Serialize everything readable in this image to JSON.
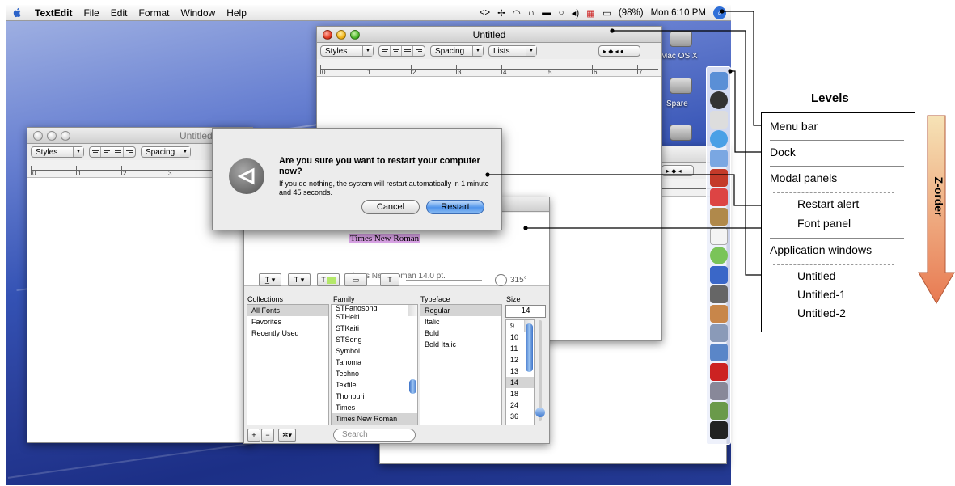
{
  "menubar": {
    "app": "TextEdit",
    "items": [
      "File",
      "Edit",
      "Format",
      "Window",
      "Help"
    ],
    "status": {
      "battery": "(98%)",
      "clock": "Mon 6:10 PM"
    }
  },
  "windows": {
    "untitled": {
      "title": "Untitled",
      "styles": "Styles",
      "spacing": "Spacing",
      "lists": "Lists",
      "ruler": [
        "0",
        "1",
        "2",
        "3",
        "4",
        "5",
        "6",
        "7"
      ]
    },
    "untitled_back": {
      "title": "Untitled",
      "styles": "Styles",
      "spacing": "Spacing",
      "ruler": [
        "0",
        "1",
        "2",
        "3"
      ]
    }
  },
  "alert": {
    "title": "Are you sure you want to restart your computer now?",
    "body": "If you do nothing, the system will restart automatically in 1 minute and 45 seconds.",
    "cancel": "Cancel",
    "restart": "Restart"
  },
  "font_panel": {
    "sample": "Times New Roman",
    "font_desc": "Times New Roman 14.0 pt.",
    "angle": "315°",
    "headers": {
      "collections": "Collections",
      "family": "Family",
      "typeface": "Typeface",
      "size": "Size"
    },
    "collections": [
      "All Fonts",
      "Favorites",
      "Recently Used"
    ],
    "families": [
      "STFangsong",
      "STHeiti",
      "STKaiti",
      "STSong",
      "Symbol",
      "Tahoma",
      "Techno",
      "Textile",
      "Thonburi",
      "Times",
      "Times New Roman"
    ],
    "typefaces": [
      "Regular",
      "Italic",
      "Bold",
      "Bold Italic"
    ],
    "size_value": "14",
    "sizes": [
      "9",
      "10",
      "11",
      "12",
      "13",
      "14",
      "18",
      "24",
      "36"
    ],
    "search": "Search"
  },
  "desktop": {
    "disks": [
      "Mac OS X",
      "Spare"
    ]
  },
  "levels": {
    "title": "Levels",
    "menu_bar": "Menu bar",
    "dock": "Dock",
    "modal_panels": "Modal panels",
    "restart_alert": "Restart alert",
    "font_panel": "Font panel",
    "application_windows": "Application windows",
    "untitled": "Untitled",
    "untitled_1": "Untitled-1",
    "untitled_2": "Untitled-2",
    "z_order": "Z-order"
  },
  "colors": {
    "arrow_top": "#f6e3b6",
    "arrow_bottom": "#e87a52",
    "sample_highlight": "#e3a9f0",
    "desktop": "#3452b4"
  }
}
